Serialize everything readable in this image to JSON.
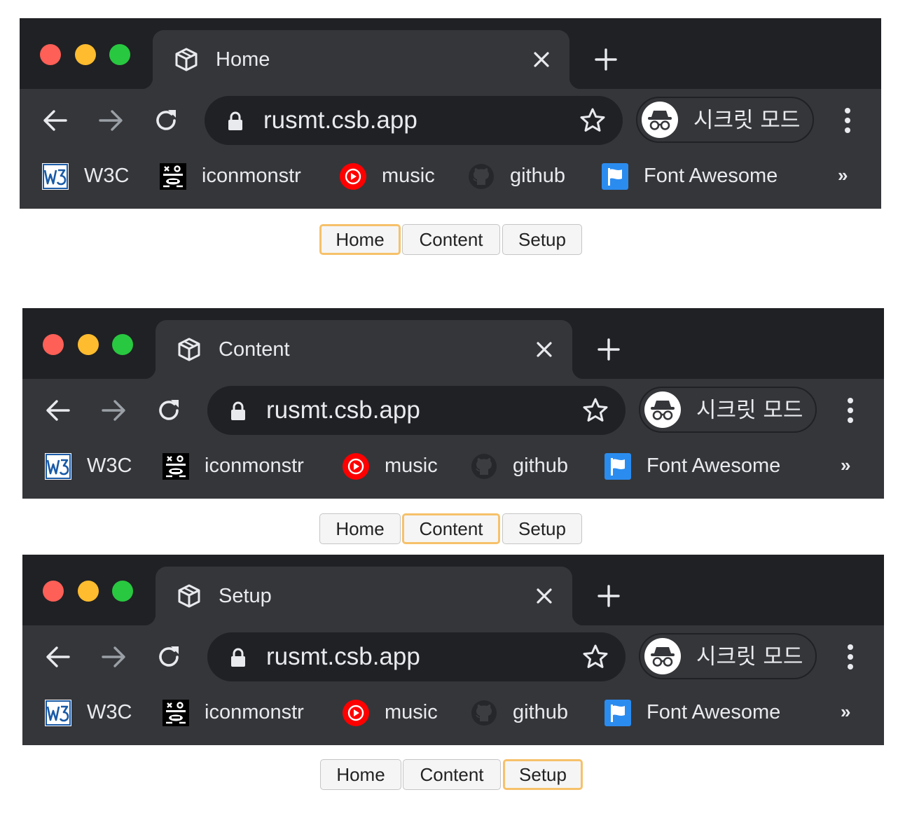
{
  "browser": {
    "url": "rusmt.csb.app",
    "incognito_label": "시크릿 모드",
    "bookmarks": [
      {
        "label": "W3C",
        "icon": "w3c-logo-icon"
      },
      {
        "label": "iconmonstr",
        "icon": "iconmonstr-logo-icon"
      },
      {
        "label": "music",
        "icon": "youtube-music-icon"
      },
      {
        "label": "github",
        "icon": "github-icon"
      },
      {
        "label": "Font Awesome",
        "icon": "font-awesome-flag-icon"
      }
    ],
    "bookmarks_more": "»",
    "icons": {
      "tab_favicon": "codesandbox-cube-icon",
      "tab_close": "close-icon",
      "new_tab": "plus-icon",
      "back": "arrow-left-icon",
      "forward": "arrow-right-icon",
      "reload": "reload-icon",
      "lock": "lock-icon",
      "star": "star-icon",
      "incognito": "incognito-icon",
      "menu": "kebab-menu-icon"
    }
  },
  "colors": {
    "titlebar": "#202124",
    "toolbar": "#35363a",
    "text": "#e8eaed",
    "active_border": "#f6c16a",
    "traffic_red": "#fe5f57",
    "traffic_yellow": "#febc2e",
    "traffic_green": "#28c840"
  },
  "panels": [
    {
      "tab_title": "Home",
      "active_button": "Home"
    },
    {
      "tab_title": "Content",
      "active_button": "Content"
    },
    {
      "tab_title": "Setup",
      "active_button": "Setup"
    }
  ],
  "buttons": [
    "Home",
    "Content",
    "Setup"
  ]
}
